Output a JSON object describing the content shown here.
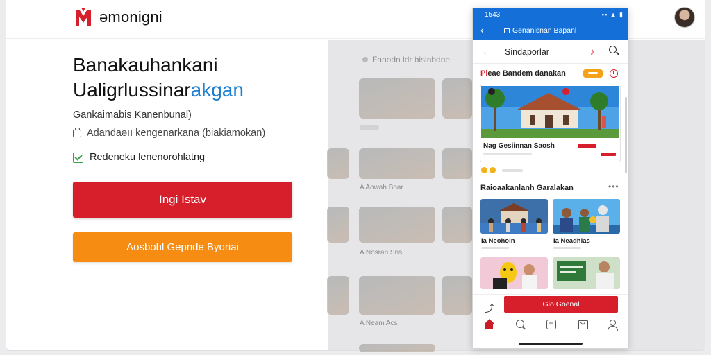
{
  "app": {
    "brand": "əmonigni",
    "brand_color": "#d71f2c",
    "accent_color": "#1e7fd0"
  },
  "hero": {
    "title_line1": "Banakauhankani",
    "title_line2_plain": "Ualigrlussinar",
    "title_line2_accent": "akgan",
    "subtitle": "Gankaimabis Kanenbunal)",
    "meta": "Adandaəıı kengenarkana (biakiamokan)",
    "meta_icon": "printer-icon",
    "checkbox_label": "Redeneku lenenorohlatng",
    "checkbox_checked": true
  },
  "buttons": {
    "primary": "Ingi Istav",
    "secondary": "Aosbohl Gepnde Byoriai"
  },
  "background_panel": {
    "heading": "Fanodn ldr bisinbdne",
    "captions": [
      "A Aowah Boar",
      "A Nosran Sns",
      "A Neam Acs"
    ]
  },
  "phone": {
    "status_time": "1543",
    "status_icons": "▪▪ ▲ ▮",
    "url": "Genanisnan Bapanl",
    "nav_title": "Sindaporlar",
    "section1_first": "Pl",
    "section1_rest": "eae Bandem danakan",
    "card_title": "Nag Gesiinnan Saosh",
    "section2": "Raioaakanlanh Garalakan",
    "more": "•••",
    "thumbs": [
      "Ia Neoholn",
      "Ia Neadhlas"
    ],
    "cta": "Gio Goenal",
    "tabs": [
      "home-icon",
      "search-icon",
      "add-icon",
      "inbox-icon",
      "profile-icon"
    ]
  }
}
